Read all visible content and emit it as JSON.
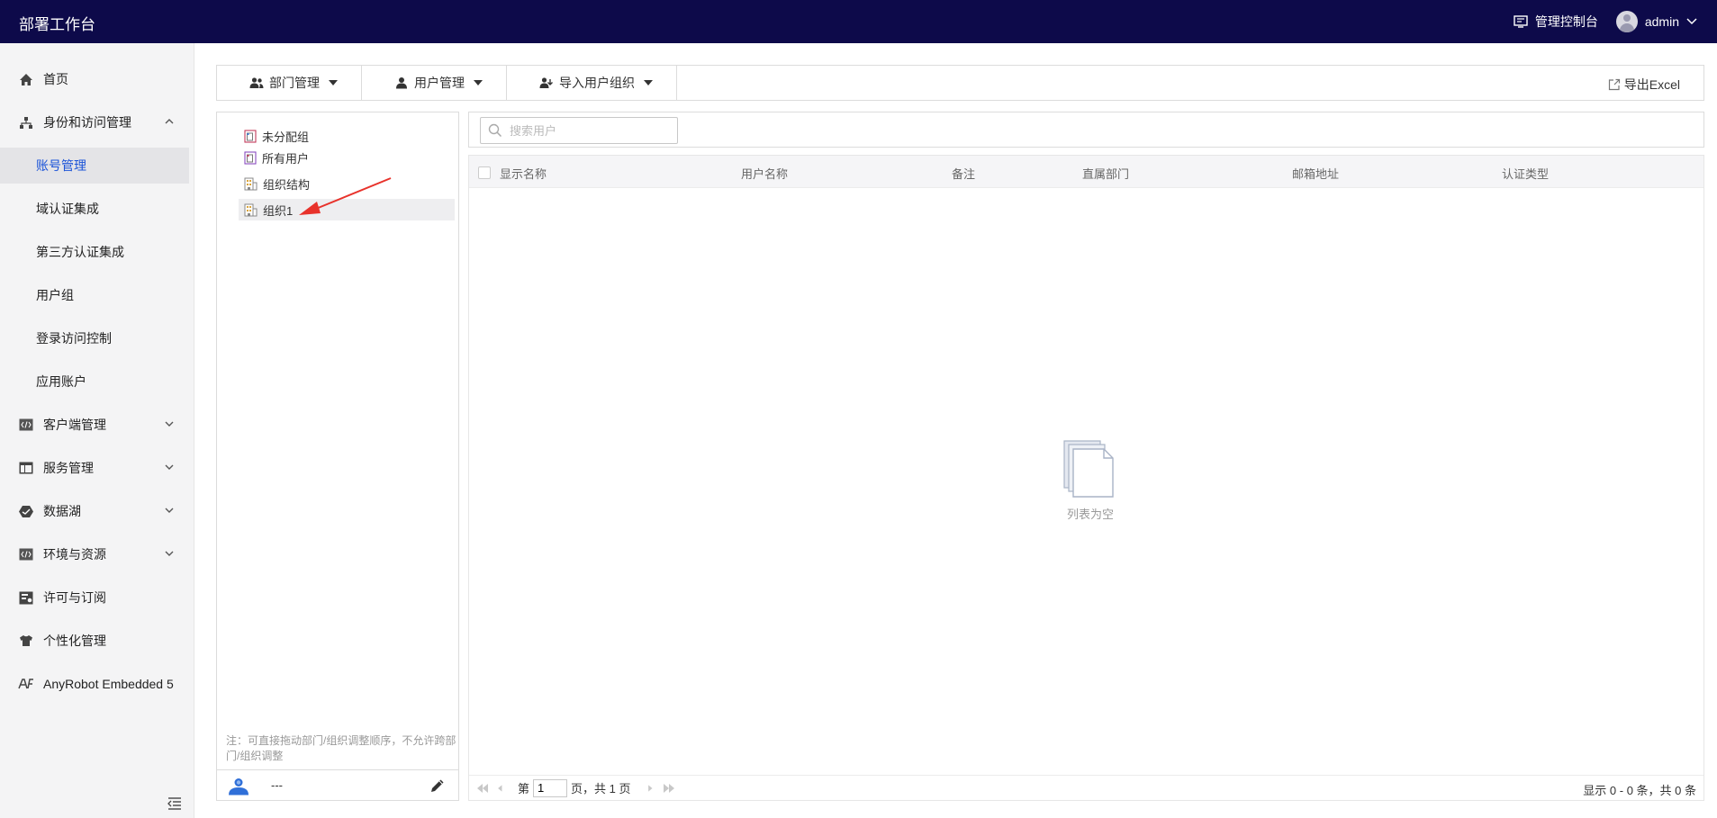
{
  "header": {
    "app_title": "部署工作台",
    "console_label": "管理控制台",
    "user_name": "admin"
  },
  "sidebar": {
    "items": [
      {
        "label": "首页",
        "icon": "home-icon"
      },
      {
        "label": "身份和访问管理",
        "icon": "org-icon",
        "expanded": true
      },
      {
        "label": "客户端管理",
        "icon": "code-icon"
      },
      {
        "label": "服务管理",
        "icon": "table-icon"
      },
      {
        "label": "数据湖",
        "icon": "datalake-icon"
      },
      {
        "label": "环境与资源",
        "icon": "code-icon"
      },
      {
        "label": "许可与订阅",
        "icon": "license-icon"
      },
      {
        "label": "个性化管理",
        "icon": "shirt-icon"
      },
      {
        "label": "AnyRobot Embedded 5",
        "icon": "anyrobot-icon"
      }
    ],
    "sub_items": [
      {
        "label": "账号管理",
        "active": true
      },
      {
        "label": "域认证集成"
      },
      {
        "label": "第三方认证集成"
      },
      {
        "label": "用户组"
      },
      {
        "label": "登录访问控制"
      },
      {
        "label": "应用账户"
      }
    ]
  },
  "toolbar": {
    "dept_label": "部门管理",
    "user_label": "用户管理",
    "import_label": "导入用户组织",
    "export_label": "导出Excel"
  },
  "tree": {
    "items": [
      {
        "label": "未分配组",
        "icon": "group-icon"
      },
      {
        "label": "所有用户",
        "icon": "group-icon"
      },
      {
        "label": "组织结构",
        "icon": "building-icon"
      },
      {
        "label": "组织1",
        "icon": "building-icon",
        "selected": true
      }
    ],
    "note": "注：可直接拖动部门/组织调整顺序，不允许跨部门/组织调整",
    "footer_text": "---"
  },
  "search": {
    "placeholder": "搜索用户"
  },
  "table": {
    "columns": [
      "显示名称",
      "用户名称",
      "备注",
      "直属部门",
      "邮箱地址",
      "认证类型"
    ],
    "rows": [],
    "empty_text": "列表为空"
  },
  "pagination": {
    "page_prefix": "第",
    "current_page": "1",
    "page_suffix": "页，共 1 页",
    "summary": "显示 0 - 0 条，共 0 条"
  },
  "colors": {
    "header_bg": "#0d0a4a",
    "active_link": "#1a53d8",
    "annotation_arrow": "#e8322b"
  }
}
